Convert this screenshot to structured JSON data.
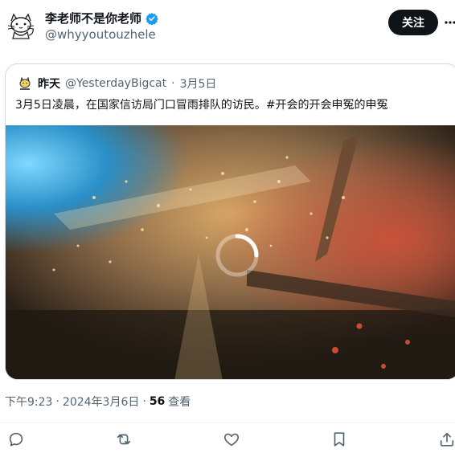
{
  "author": {
    "display_name": "李老师不是你老师",
    "handle": "@whyyoutouzhele"
  },
  "header": {
    "follow_label": "关注"
  },
  "quoted_tweet": {
    "display_name": "昨天",
    "handle": "@YesterdayBigcat",
    "separator": "·",
    "date": "3月5日",
    "text": "3月5日凌晨，在国家信访局门口冒雨排队的访民。#开会的开会申冤的申冤"
  },
  "meta": {
    "time": "下午9:23",
    "sep1": "·",
    "date": "2024年3月6日",
    "sep2": "·",
    "views_count": "56",
    "views_label": "查看"
  },
  "actions": {
    "icons": [
      "reply-icon",
      "retweet-icon",
      "like-icon",
      "bookmark-icon",
      "share-icon"
    ]
  },
  "colors": {
    "text": "#0f1419",
    "secondary": "#536471",
    "verified": "#1d9bf0",
    "border": "#cfd9de"
  }
}
